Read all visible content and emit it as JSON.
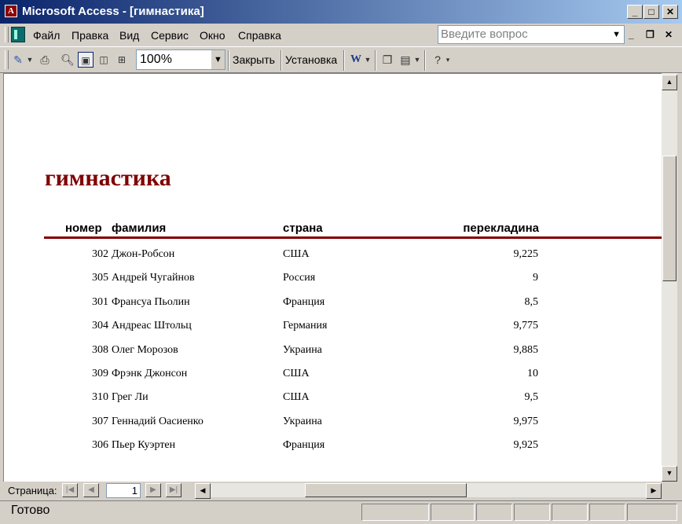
{
  "window": {
    "title": "Microsoft Access - [гимнастика]"
  },
  "menu": {
    "items": [
      "Файл",
      "Правка",
      "Вид",
      "Сервис",
      "Окно",
      "Справка"
    ],
    "help_placeholder": "Введите вопрос"
  },
  "toolbar": {
    "zoom": "100%",
    "close_label": "Закрыть",
    "setup_label": "Установка"
  },
  "report": {
    "title": "гимнастика",
    "columns": [
      "номер",
      "фамилия",
      "страна",
      "перекладина"
    ],
    "rows": [
      [
        "302",
        "Джон-Робсон",
        "США",
        "9,225"
      ],
      [
        "305",
        "Андрей Чугайнов",
        "Россия",
        "9"
      ],
      [
        "301",
        "Франсуа Пьолин",
        "Франция",
        "8,5"
      ],
      [
        "304",
        "Андреас Штольц",
        "Германия",
        "9,775"
      ],
      [
        "308",
        "Олег Морозов",
        "Украина",
        "9,885"
      ],
      [
        "309",
        "Фрэнк Джонсон",
        "США",
        "10"
      ],
      [
        "310",
        "Грег Ли",
        "США",
        "9,5"
      ],
      [
        "307",
        "Геннадий Оасиенко",
        "Украина",
        "9,975"
      ],
      [
        "306",
        "Пьер Куэртен",
        "Франция",
        "9,925"
      ]
    ]
  },
  "navigation": {
    "page_label": "Страница:",
    "page_value": "1"
  },
  "status": {
    "text": "Готово"
  },
  "colors": {
    "title_bar": "#0a246a",
    "report_accent": "#800000"
  }
}
